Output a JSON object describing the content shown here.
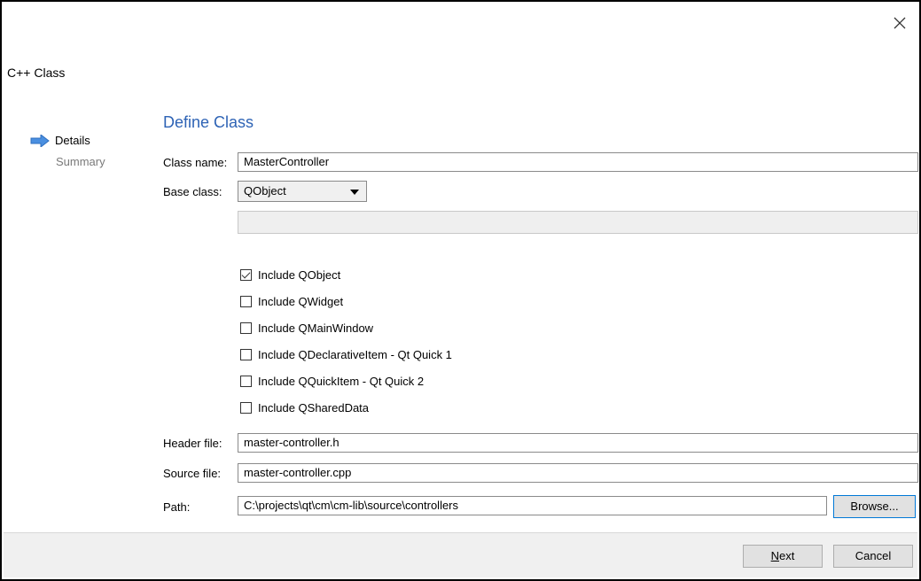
{
  "window": {
    "title": "C++ Class",
    "close_glyph": "×"
  },
  "nav": {
    "items": [
      {
        "label": "Details",
        "active": true
      },
      {
        "label": "Summary",
        "active": false
      }
    ]
  },
  "form": {
    "section_title": "Define Class",
    "class_name": {
      "label": "Class name:",
      "value": "MasterController"
    },
    "base_class": {
      "label": "Base class:",
      "value": "QObject"
    },
    "includes": [
      {
        "label": "Include QObject",
        "checked": true
      },
      {
        "label": "Include QWidget",
        "checked": false
      },
      {
        "label": "Include QMainWindow",
        "checked": false
      },
      {
        "label": "Include QDeclarativeItem - Qt Quick 1",
        "checked": false
      },
      {
        "label": "Include QQuickItem - Qt Quick 2",
        "checked": false
      },
      {
        "label": "Include QSharedData",
        "checked": false
      }
    ],
    "header_file": {
      "label": "Header file:",
      "value": "master-controller.h"
    },
    "source_file": {
      "label": "Source file:",
      "value": "master-controller.cpp"
    },
    "path": {
      "label": "Path:",
      "value": "C:\\projects\\qt\\cm\\cm-lib\\source\\controllers"
    },
    "browse_label": "Browse..."
  },
  "footer": {
    "next_label_mnemonic": "N",
    "next_label_rest": "ext",
    "cancel_label": "Cancel"
  },
  "colors": {
    "accent": "#2e63b5",
    "arrow": "#4a8fe0"
  }
}
